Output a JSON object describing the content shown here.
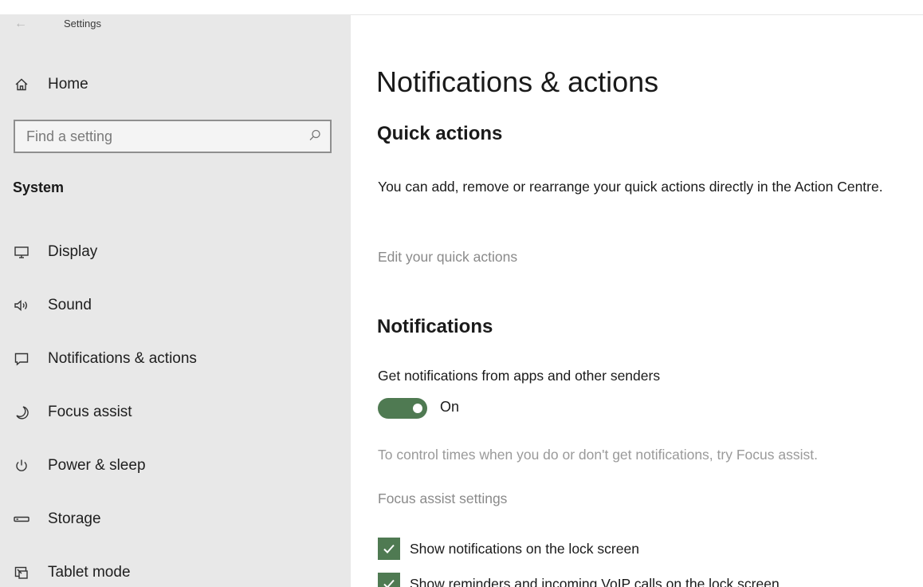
{
  "window": {
    "title": "Settings",
    "back_glyph": "←"
  },
  "sidebar": {
    "home_label": "Home",
    "search": {
      "placeholder": "Find a setting",
      "value": ""
    },
    "section_heading": "System",
    "items": [
      {
        "label": "Display",
        "icon": "display-icon"
      },
      {
        "label": "Sound",
        "icon": "speaker-icon"
      },
      {
        "label": "Notifications & actions",
        "icon": "notification-icon"
      },
      {
        "label": "Focus assist",
        "icon": "moon-icon"
      },
      {
        "label": "Power & sleep",
        "icon": "power-icon"
      },
      {
        "label": "Storage",
        "icon": "storage-icon"
      },
      {
        "label": "Tablet mode",
        "icon": "tablet-icon"
      }
    ]
  },
  "main": {
    "page_title": "Notifications & actions",
    "quick_actions": {
      "heading": "Quick actions",
      "description": "You can add, remove or rearrange your quick actions directly in the Action Centre.",
      "edit_link": "Edit your quick actions"
    },
    "notifications": {
      "heading": "Notifications",
      "get_notifications_label": "Get notifications from apps and other senders",
      "toggle": {
        "state": "On",
        "on": true
      },
      "focus_hint": "To control times when you do or don't get notifications, try Focus assist.",
      "focus_link": "Focus assist settings",
      "checkboxes": [
        {
          "label": "Show notifications on the lock screen",
          "checked": true
        },
        {
          "label": "Show reminders and incoming VoIP calls on the lock screen",
          "checked": true
        }
      ]
    }
  },
  "colors": {
    "accent": "#4f7a52",
    "sidebar_bg": "#e8e8e8",
    "link": "#8a8a8a",
    "muted_text": "#9a9a9a"
  }
}
